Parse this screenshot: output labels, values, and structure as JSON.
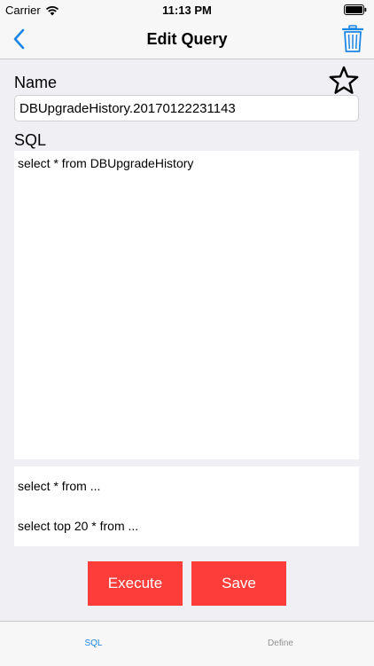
{
  "status_bar": {
    "carrier": "Carrier",
    "time": "11:13 PM"
  },
  "nav": {
    "title": "Edit Query",
    "back_icon": "chevron-left-icon",
    "trash_icon": "trash-icon"
  },
  "form": {
    "name_label": "Name",
    "name_value": "DBUpgradeHistory.20170122231143",
    "sql_label": "SQL",
    "sql_value": "select * from DBUpgradeHistory",
    "star_icon": "star-outline-icon"
  },
  "snippets": [
    "select * from ...",
    "select top 20 * from ..."
  ],
  "buttons": {
    "execute_label": "Execute",
    "save_label": "Save"
  },
  "tabs": [
    {
      "label": "SQL",
      "active": true
    },
    {
      "label": "Define",
      "active": false
    }
  ],
  "colors": {
    "accent": "#1a86e6",
    "button_red": "#fc3d39",
    "background": "#efeff4",
    "inactive_tab": "#929292"
  }
}
